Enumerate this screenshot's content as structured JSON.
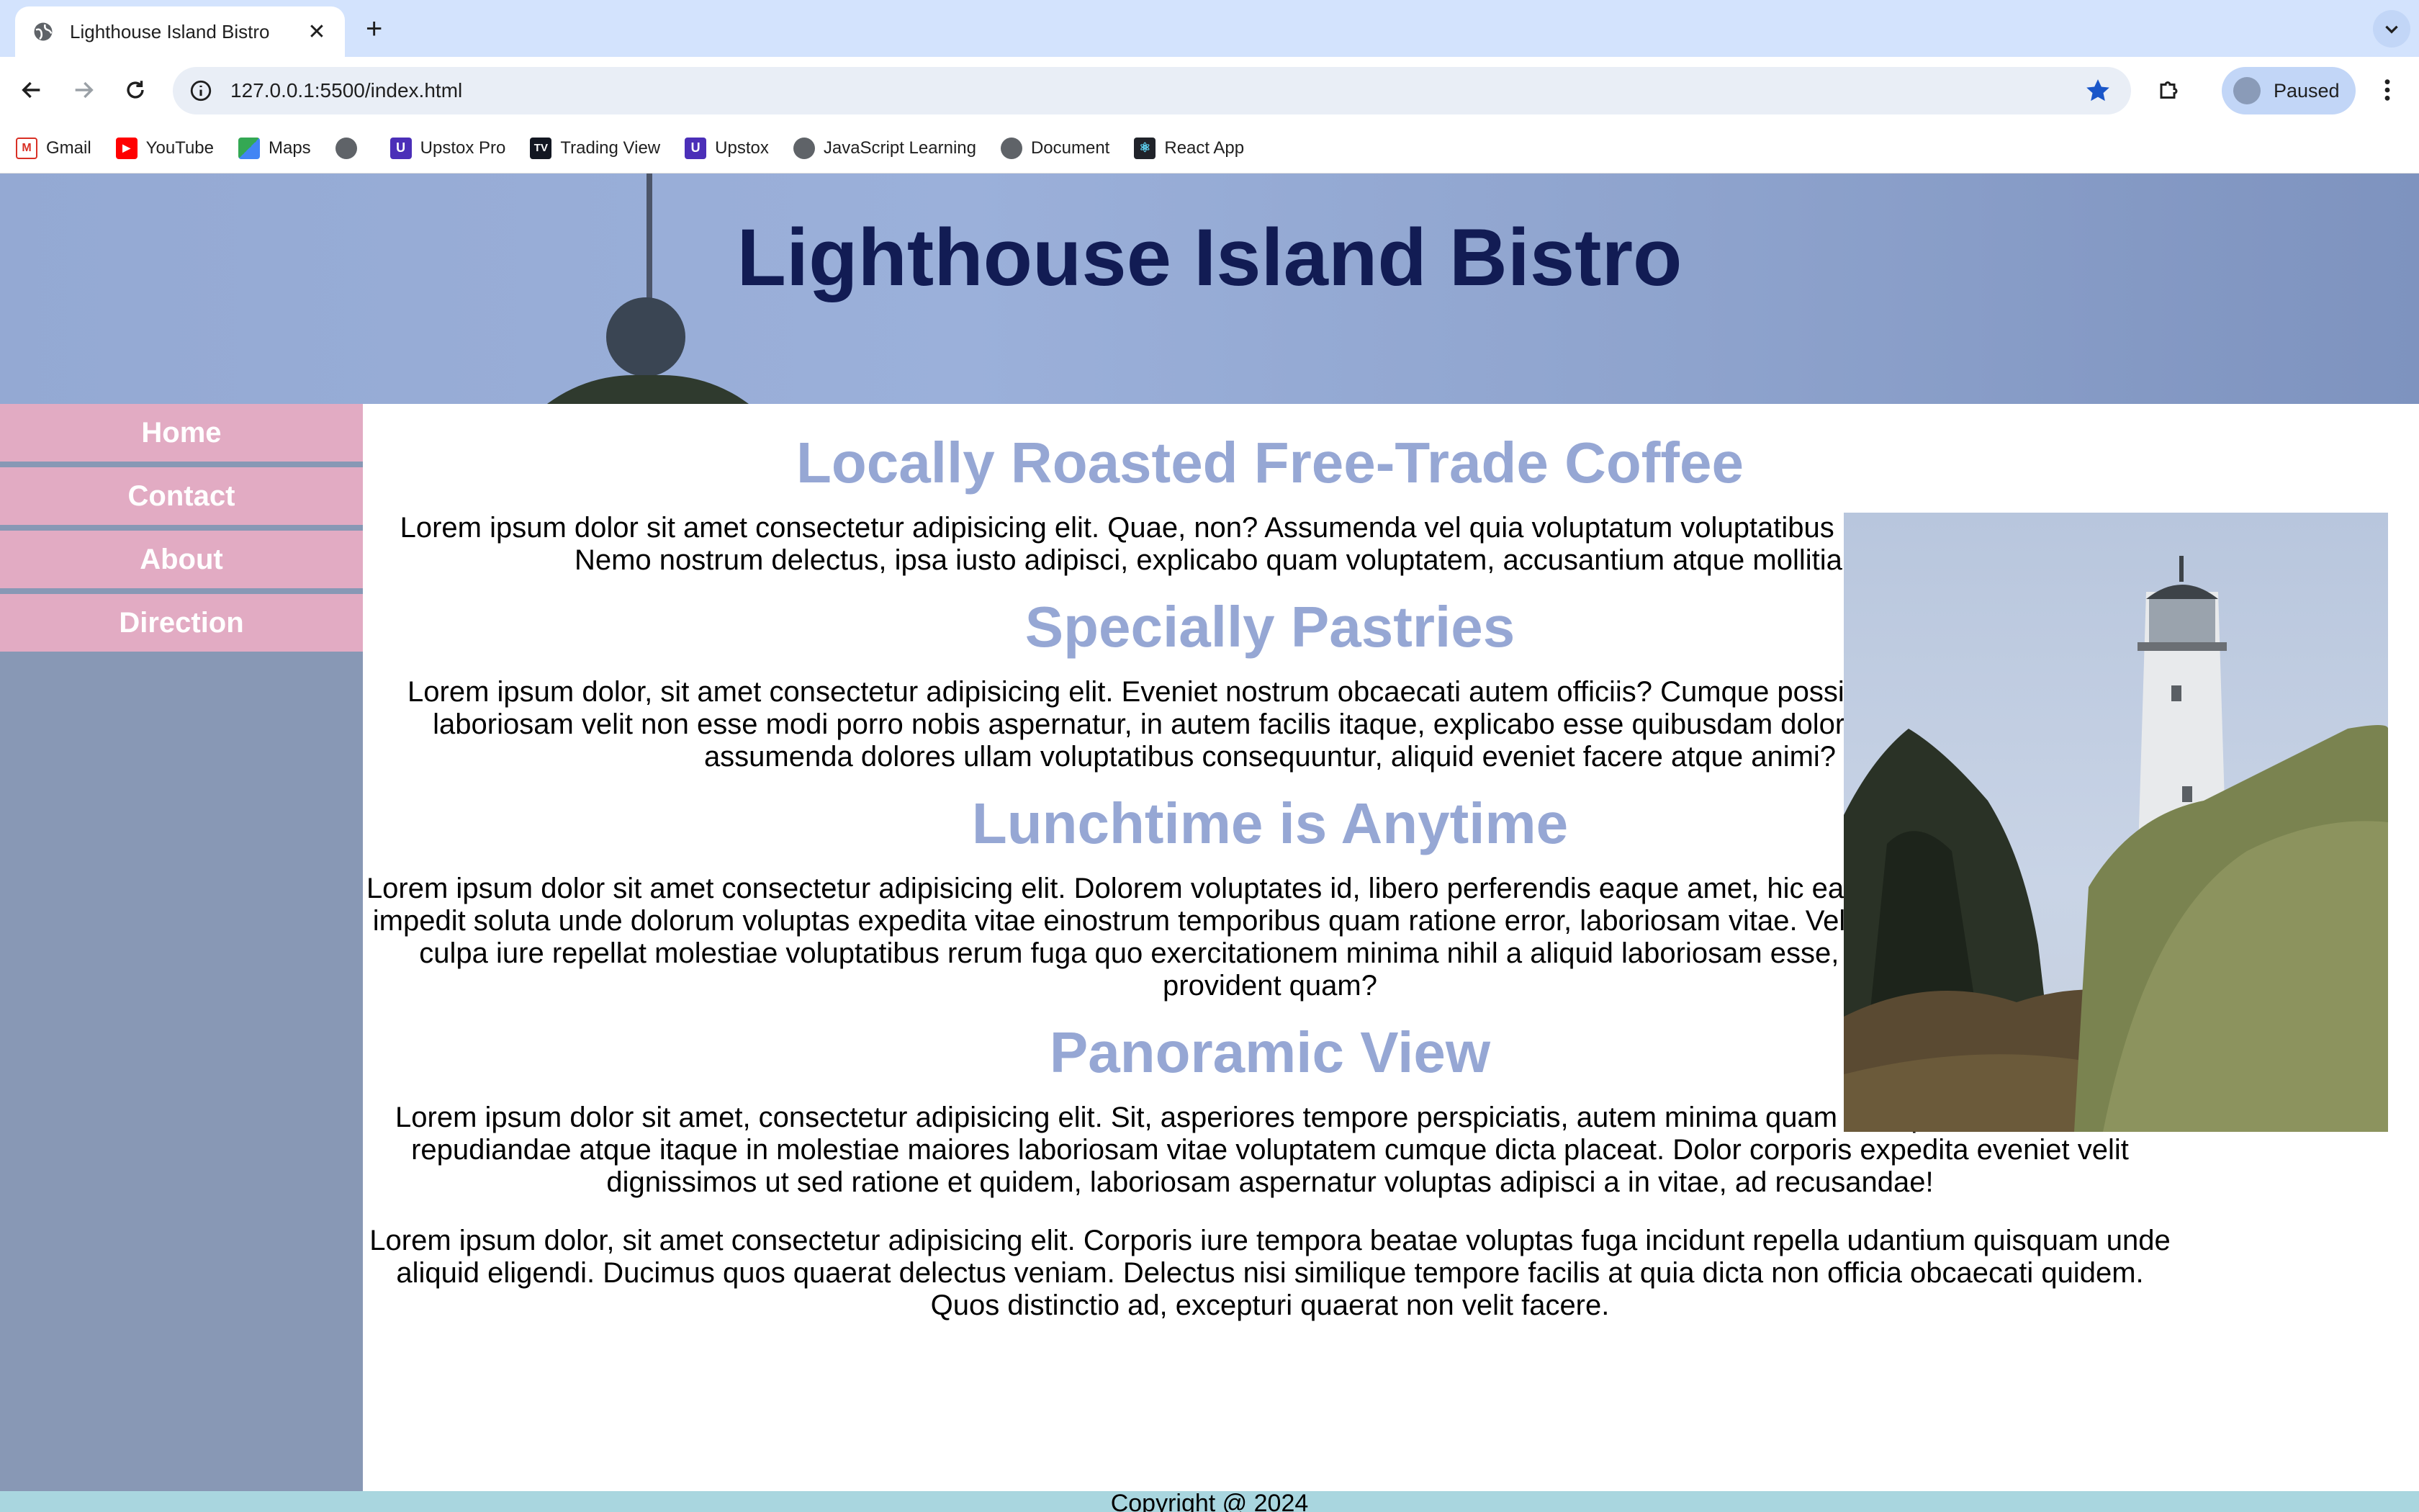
{
  "browser": {
    "tab_title": "Lighthouse Island Bistro",
    "new_tab_label": "+",
    "url": "127.0.0.1:5500/index.html",
    "profile_label": "Paused",
    "bookmarks": [
      {
        "label": "Gmail",
        "icon": "gmail-icon"
      },
      {
        "label": "YouTube",
        "icon": "youtube-icon"
      },
      {
        "label": "Maps",
        "icon": "maps-icon"
      },
      {
        "label": "",
        "icon": "globe-icon"
      },
      {
        "label": "Upstox Pro",
        "icon": "upstox-icon"
      },
      {
        "label": "Trading View",
        "icon": "tradingview-icon"
      },
      {
        "label": "Upstox",
        "icon": "upstox-icon"
      },
      {
        "label": "JavaScript Learning",
        "icon": "globe-icon"
      },
      {
        "label": "Document",
        "icon": "globe-icon"
      },
      {
        "label": "React App",
        "icon": "react-icon"
      }
    ]
  },
  "page": {
    "title": "Lighthouse Island Bistro",
    "nav": [
      "Home",
      "Contact",
      "About",
      "Direction"
    ],
    "sections": [
      {
        "heading": "Locally Roasted Free-Trade Coffee",
        "text": "Lorem ipsum dolor sit amet consectetur adipisicing elit. Quae, non? Assumenda vel quia voluptatum voluptatibus nihil oloribus molestias! Nemo nostrum delectus, ipsa iusto adipisci, explicabo quam voluptatem, accusantium atque mollitia ducimus."
      },
      {
        "heading": "Specially Pastries",
        "text": "Lorem ipsum dolor, sit amet consectetur adipisicing elit. Eveniet nostrum obcaecati autem officiis? Cumque possimus, amet ipsum dicta laboriosam velit non esse modi porro nobis aspernatur, in autem facilis itaque, explicabo esse quibusdam doloremque, praesentium assumenda dolores ullam voluptatibus consequuntur, aliquid eveniet facere atque animi?"
      },
      {
        "heading": "Lunchtime is Anytime",
        "text": "Lorem ipsum dolor sit amet consectetur adipisicing elit. Dolorem voluptates id, libero perferendis eaque amet, hic earum similique deserunt, ut impedit soluta unde dolorum voluptas expedita vitae einostrum temporibus quam ratione error, laboriosam vitae. Vel cum quas consequuntur, culpa iure repellat molestiae voluptatibus rerum fuga quo exercitationem minima nihil a aliquid laboriosam esse, quae magnam harum provident quam?"
      },
      {
        "heading": "Panoramic View",
        "text": "Lorem ipsum dolor sit amet, consectetur adipisicing elit. Sit, asperiores tempore perspiciatis, autem minima quam suscipit debitis nostrum repudiandae atque itaque in molestiae maiores laboriosam vitae voluptatem cumque dicta placeat. Dolor corporis expedita eveniet velit dignissimos ut sed ratione et quidem, laboriosam aspernatur voluptas adipisci a in vitae, ad recusandae!"
      }
    ],
    "extra_paragraph": "Lorem ipsum dolor, sit amet consectetur adipisicing elit. Corporis iure tempora beatae voluptas fuga incidunt repella udantium quisquam unde aliquid eligendi. Ducimus quos quaerat delectus veniam. Delectus nisi similique tempore facilis at quia dicta non officia obcaecati quidem. Quos distinctio ad, excepturi quaerat non velit facere.",
    "footer": "Copyright @ 2024"
  },
  "colors": {
    "heading": "#96a7d4",
    "title": "#121c54",
    "nav_bg": "#e2abc3",
    "sidebar_bg": "#8898b5",
    "footer_bg": "#a9d6df"
  }
}
